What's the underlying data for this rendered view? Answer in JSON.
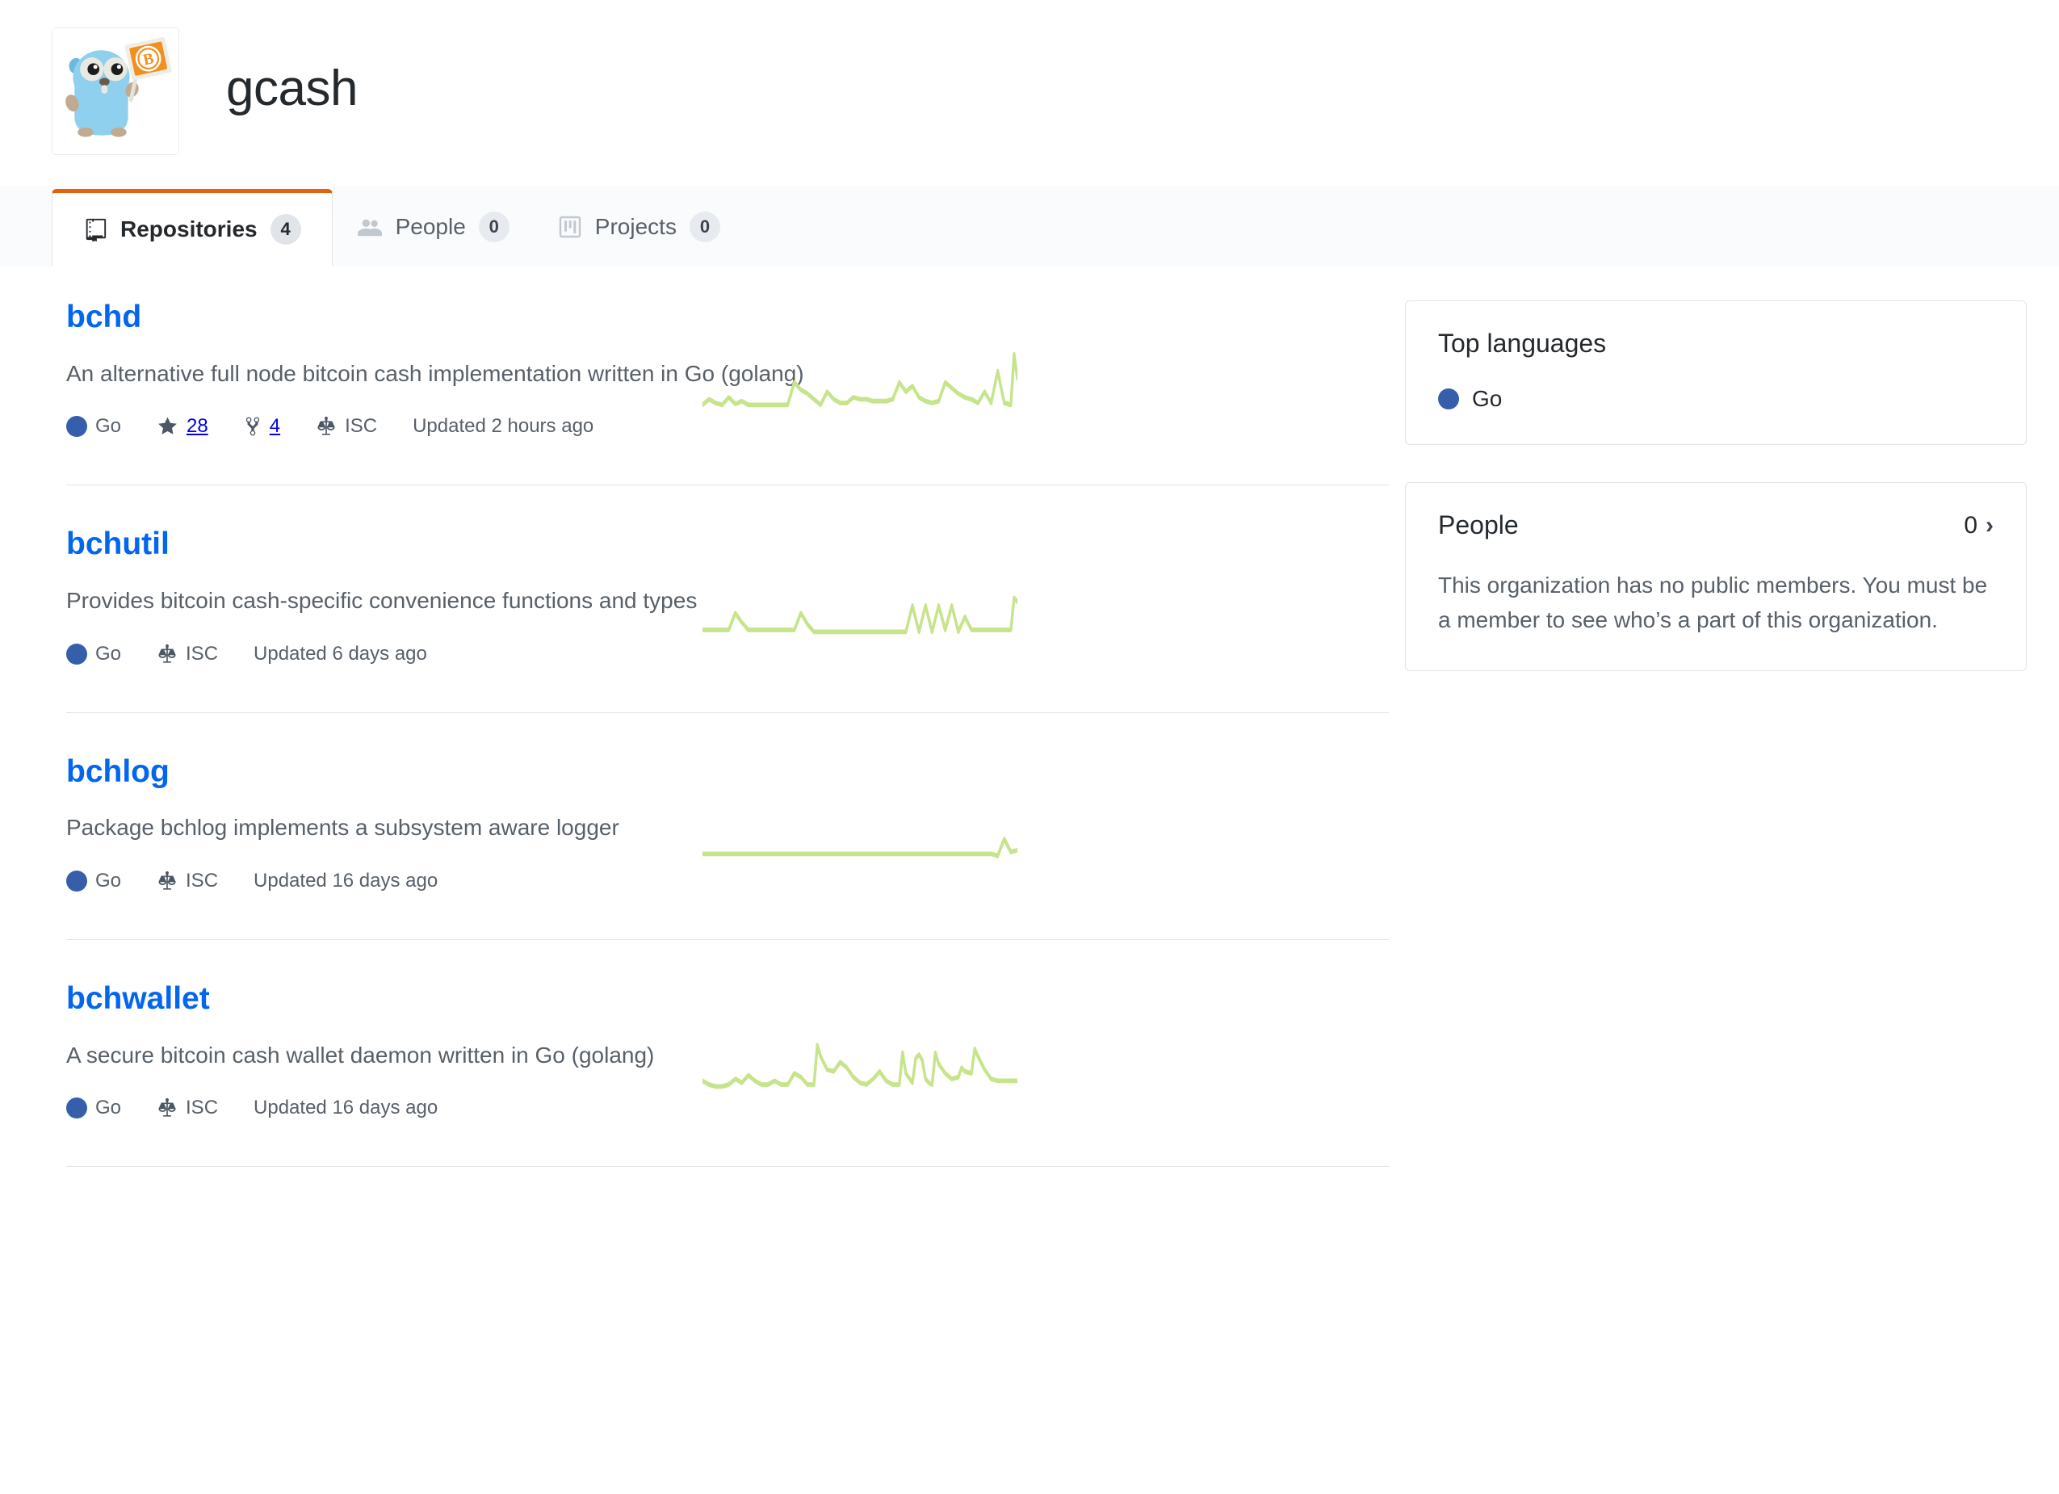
{
  "org": {
    "name": "gcash",
    "avatar_alt": "gopher-bitcoin-cash-logo"
  },
  "tabs": [
    {
      "id": "repositories",
      "label": "Repositories",
      "count": "4",
      "icon": "repo-icon",
      "selected": true
    },
    {
      "id": "people",
      "label": "People",
      "count": "0",
      "icon": "people-icon",
      "selected": false
    },
    {
      "id": "projects",
      "label": "Projects",
      "count": "0",
      "icon": "project-icon",
      "selected": false
    }
  ],
  "repositories": [
    {
      "name": "bchd",
      "description": "An alternative full node bitcoin cash implementation written in Go (golang)",
      "language": "Go",
      "language_color": "#375eab",
      "stars": "28",
      "forks": "4",
      "license": "ISC",
      "updated": "Updated 2 hours ago",
      "sparkline": "0,58 12,52 24,56 36,58 48,50 60,57 72,54 84,58 96,58 108,58 120,58 132,58 144,58 156,58 168,34 180,42 192,46 204,52 216,58 228,44 240,52 252,56 264,56 276,50 288,52 300,52 312,54 324,54 336,54 348,52 360,34 372,44 384,38 396,50 408,54 420,56 432,54 444,34 456,40 468,46 480,50 492,52 504,56 516,44 528,56 540,22 552,56 564,58 570,4 576,30"
    },
    {
      "name": "bchutil",
      "description": "Provides bitcoin cash-specific convenience functions and types",
      "language": "Go",
      "language_color": "#375eab",
      "stars": "",
      "forks": "",
      "license": "ISC",
      "updated": "Updated 6 days ago",
      "sparkline": "0,56 24,56 48,56 60,38 72,48 84,56 96,56 120,56 144,56 168,56 180,38 192,50 204,58 228,58 252,58 276,58 300,58 324,58 348,58 372,58 384,30 396,58 408,30 420,58 432,30 444,56 456,30 468,58 480,42 492,56 516,56 540,56 552,56 564,56 570,22 576,26"
    },
    {
      "name": "bchlog",
      "description": "Package bchlog implements a subsystem aware logger",
      "language": "Go",
      "language_color": "#375eab",
      "stars": "",
      "forks": "",
      "license": "ISC",
      "updated": "Updated 16 days ago",
      "sparkline": "0,52 60,52 120,52 180,52 240,52 300,52 360,52 420,52 480,52 528,52 540,54 552,36 564,50 576,48"
    },
    {
      "name": "bchwallet",
      "description": "A secure bitcoin cash wallet daemon written in Go (golang)",
      "language": "Go",
      "language_color": "#375eab",
      "stars": "",
      "forks": "",
      "license": "ISC",
      "updated": "Updated 16 days ago",
      "sparkline": "0,52 12,56 24,58 36,58 48,56 60,50 72,54 84,46 96,52 108,56 120,56 132,52 144,56 156,56 168,44 180,48 192,56 204,56 210,14 216,26 228,40 240,42 252,32 264,38 276,48 288,54 300,56 312,50 324,42 336,52 348,56 360,56 366,22 372,44 384,54 390,28 396,24 402,30 408,50 414,54 420,56 426,22 432,34 444,44 456,50 468,48 474,38 480,42 492,44 498,18 504,26 516,40 528,50 540,52 552,52 564,52 576,52"
    }
  ],
  "sidebar": {
    "top_languages": {
      "title": "Top languages",
      "languages": [
        {
          "name": "Go",
          "color": "#375eab"
        }
      ]
    },
    "people": {
      "title": "People",
      "count": "0",
      "chevron": "›",
      "empty_message": "This organization has no public members. You must be a member to see who’s a part of this organization."
    }
  },
  "colors": {
    "link": "#0366ee",
    "active_tab_border": "#e36209",
    "go": "#375eab",
    "sparkline": "#c6e48b",
    "sparkline_peak": "#7bc96f",
    "border": "#e1e4e8",
    "muted_text": "#586069"
  }
}
